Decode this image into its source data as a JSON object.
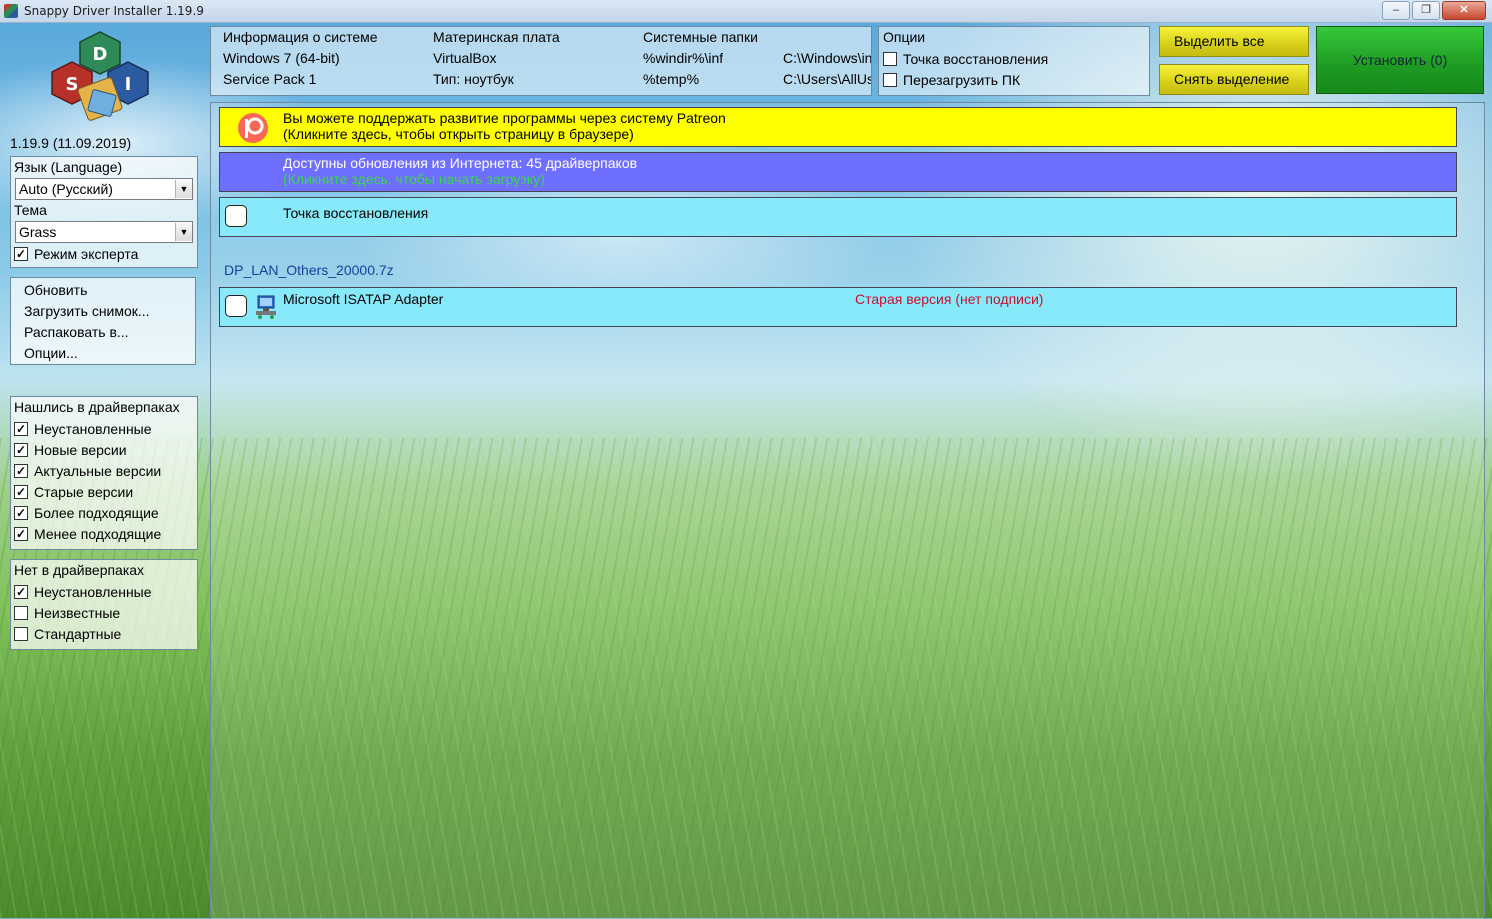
{
  "window": {
    "title": "Snappy Driver Installer 1.19.9",
    "minimize": "–",
    "maximize": "❐",
    "close": "✕"
  },
  "logo": {
    "letters": [
      "D",
      "S",
      "I"
    ]
  },
  "version": "1.19.9 (11.09.2019)",
  "settings": {
    "language_label": "Язык (Language)",
    "language_value": "Auto (Русский)",
    "theme_label": "Тема",
    "theme_value": "Grass",
    "expert_mode": {
      "label": "Режим эксперта",
      "checked": true
    }
  },
  "actions": [
    "Обновить",
    "Загрузить снимок...",
    "Распаковать в...",
    "Опции..."
  ],
  "found_filters": {
    "title": "Нашлись в драйверпаках",
    "items": [
      {
        "label": "Неустановленные",
        "checked": true
      },
      {
        "label": "Новые версии",
        "checked": true
      },
      {
        "label": "Актуальные версии",
        "checked": true
      },
      {
        "label": "Старые версии",
        "checked": true
      },
      {
        "label": "Более подходящие",
        "checked": true
      },
      {
        "label": "Менее подходящие",
        "checked": true
      }
    ]
  },
  "missing_filters": {
    "title": "Нет в драйверпаках",
    "items": [
      {
        "label": "Неустановленные",
        "checked": true
      },
      {
        "label": "Неизвестные",
        "checked": false
      },
      {
        "label": "Стандартные",
        "checked": false
      }
    ]
  },
  "sysinfo": {
    "col1": [
      "Информация о системе",
      "Windows 7 (64-bit)",
      "Service Pack 1"
    ],
    "col2": [
      "Материнская плата",
      "VirtualBox",
      "Тип: ноутбук"
    ],
    "col3": [
      "Системные папки",
      "%windir%\\inf",
      "%temp%"
    ],
    "col4": [
      "",
      "C:\\Windows\\inf",
      "C:\\Users\\AllUsers"
    ]
  },
  "options": {
    "title": "Опции",
    "restore_point": {
      "label": "Точка восстановления",
      "checked": false
    },
    "reboot": {
      "label": "Перезагрузить ПК",
      "checked": false
    }
  },
  "buttons": {
    "select_all": "Выделить все",
    "deselect": "Снять выделение",
    "install": "Установить (0)"
  },
  "patreon": {
    "line1": "Вы можете поддержать развитие программы через систему Patreon",
    "line2": "(Кликните здесь, чтобы открыть страницу в браузере)"
  },
  "updates": {
    "line1": "Доступны обновления из Интернета: 45 драйверпаков",
    "line2": "(Кликните здесь, чтобы начать загрузку)"
  },
  "restore_row": {
    "label": "Точка восстановления"
  },
  "driverpack": "DP_LAN_Others_20000.7z",
  "driver": {
    "name": "Microsoft ISATAP Adapter",
    "status": "Старая версия (нет подписи)"
  },
  "colors": {
    "patreon_bg": "#ffff00",
    "updates_bg": "#6f6fff",
    "row_bg": "#87e9fa",
    "status_red": "#c8102e",
    "link_green": "#3cd64a"
  }
}
